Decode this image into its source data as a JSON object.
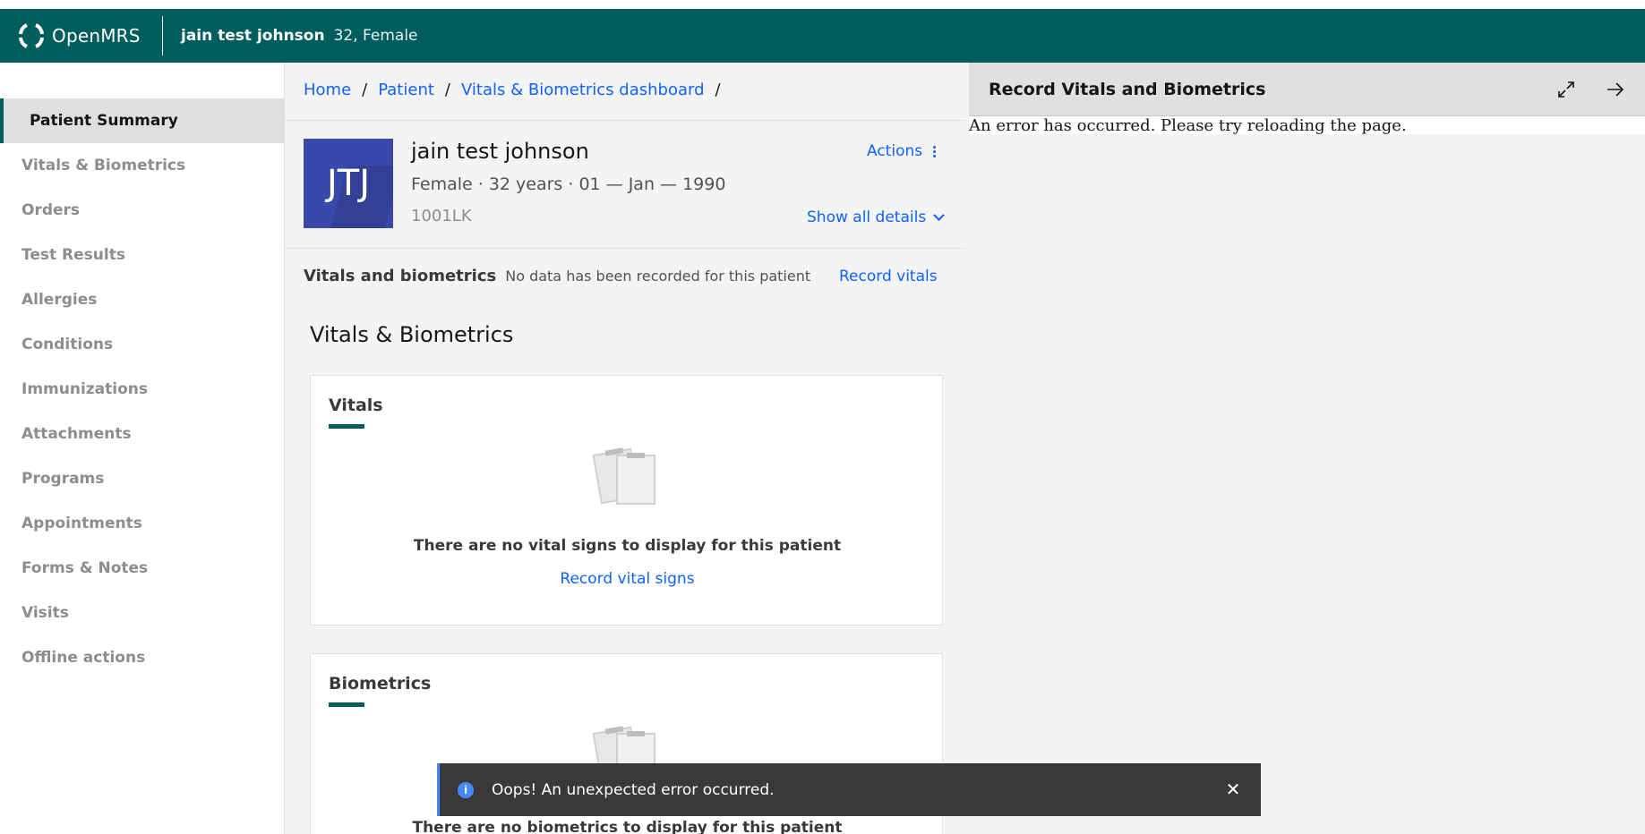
{
  "header": {
    "app_name": "OpenMRS",
    "patient_name": "jain test johnson",
    "patient_meta": "32, Female"
  },
  "leftnav": {
    "items": [
      {
        "label": "Patient Summary",
        "active": true
      },
      {
        "label": "Vitals & Biometrics"
      },
      {
        "label": "Orders"
      },
      {
        "label": "Test Results"
      },
      {
        "label": "Allergies"
      },
      {
        "label": "Conditions"
      },
      {
        "label": "Immunizations"
      },
      {
        "label": "Attachments"
      },
      {
        "label": "Programs"
      },
      {
        "label": "Appointments"
      },
      {
        "label": "Forms & Notes"
      },
      {
        "label": "Visits"
      },
      {
        "label": "Offline actions"
      }
    ]
  },
  "breadcrumb": {
    "items": [
      "Home",
      "Patient",
      "Vitals & Biometrics dashboard"
    ],
    "separator": "/"
  },
  "patient": {
    "initials": "JTJ",
    "name": "jain test johnson",
    "demographics": "Female · 32 years · 01 — Jan — 1990",
    "identifier": "1001LK",
    "actions_label": "Actions",
    "show_all_label": "Show all details"
  },
  "vitals_summary": {
    "title": "Vitals and biometrics",
    "subtitle": "No data has been recorded for this patient",
    "link": "Record vitals"
  },
  "section": {
    "title": "Vitals & Biometrics"
  },
  "cards": {
    "vitals": {
      "title": "Vitals",
      "empty_text": "There are no vital signs to display for this patient",
      "link": "Record vital signs"
    },
    "biometrics": {
      "title": "Biometrics",
      "empty_text": "There are no biometrics to display for this patient"
    }
  },
  "right_panel": {
    "title": "Record Vitals and Biometrics",
    "error": "An error has occurred. Please try reloading the page."
  },
  "toast": {
    "message": "Oops! An unexpected error occurred.",
    "icon": "info-icon"
  },
  "colors": {
    "brand": "#005d5d",
    "link": "#0f62fe",
    "avatar": "#3949ab",
    "toast_bg": "#393939"
  }
}
